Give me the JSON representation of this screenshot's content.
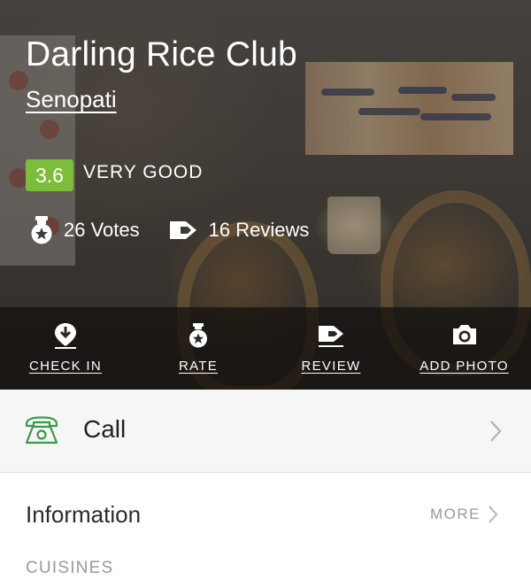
{
  "restaurant": {
    "name": "Darling Rice Club",
    "locality": "Senopati",
    "rating": "3.6",
    "rating_text": "VERY GOOD",
    "votes": "26 Votes",
    "reviews": "16 Reviews"
  },
  "actions": [
    {
      "label": "CHECK IN",
      "icon": "check-in-icon"
    },
    {
      "label": "RATE",
      "icon": "rate-medal-icon"
    },
    {
      "label": "REVIEW",
      "icon": "review-pen-icon"
    },
    {
      "label": "ADD PHOTO",
      "icon": "camera-icon"
    }
  ],
  "call": {
    "label": "Call",
    "icon": "telephone-icon"
  },
  "information": {
    "title": "Information",
    "more": "MORE",
    "cuisines_label": "CUISINES"
  },
  "colors": {
    "rating_green": "#7cbd39",
    "call_icon_green": "#3a9a4a",
    "muted_gray": "#9a9a9a"
  }
}
